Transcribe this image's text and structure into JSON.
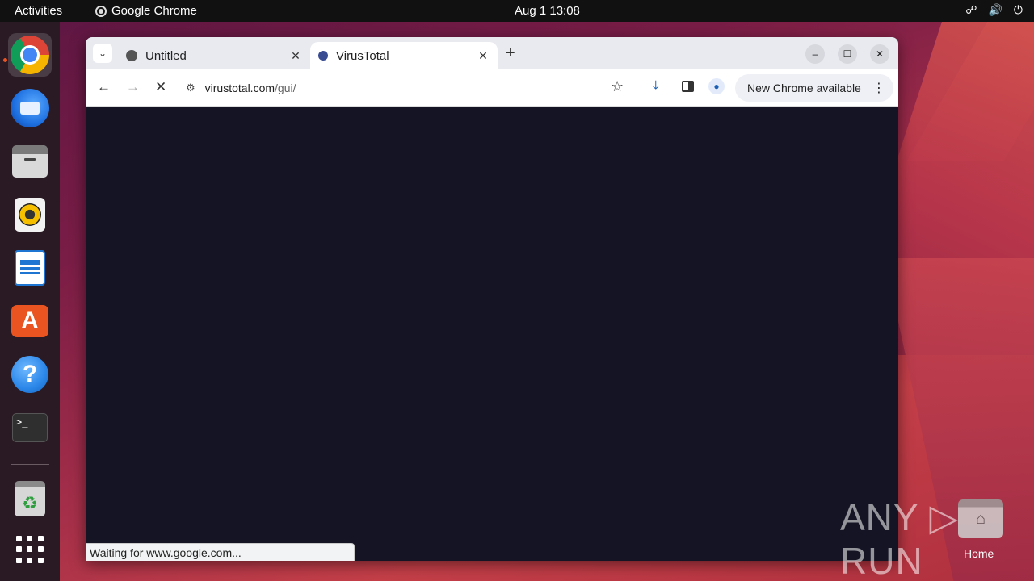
{
  "topbar": {
    "activities": "Activities",
    "app_name": "Google Chrome",
    "clock": "Aug 1  13:08",
    "tray": {
      "network": "☍",
      "volume": "🔊",
      "power": "⏻"
    }
  },
  "dock": {
    "items": [
      {
        "name": "google-chrome",
        "icon": "chrome-icon"
      },
      {
        "name": "thunderbird",
        "icon": "thunderbird-icon"
      },
      {
        "name": "files",
        "icon": "files-icon"
      },
      {
        "name": "rhythmbox",
        "icon": "rhythmbox-icon"
      },
      {
        "name": "libreoffice-writer",
        "icon": "writer-icon"
      },
      {
        "name": "app-center",
        "icon": "store-icon",
        "glyph": "A"
      },
      {
        "name": "help",
        "icon": "help-icon",
        "glyph": "?"
      },
      {
        "name": "terminal",
        "icon": "terminal-icon",
        "glyph": ">_"
      },
      {
        "name": "trash",
        "icon": "trash-icon",
        "glyph": "♻"
      },
      {
        "name": "show-apps",
        "icon": "apps-grid-icon"
      }
    ]
  },
  "browser": {
    "tabs": [
      {
        "title": "Untitled",
        "active": false
      },
      {
        "title": "VirusTotal",
        "active": true
      }
    ],
    "new_tab_glyph": "+",
    "window_controls": {
      "minimize": "–",
      "maximize": "☐",
      "close": "✕"
    },
    "toolbar": {
      "back": "←",
      "forward": "→",
      "stop": "✕",
      "url_host": "virustotal.com",
      "url_path": "/gui/",
      "bookmark_star": "☆",
      "download": "⤓",
      "profile": "●",
      "update_label": "New Chrome available",
      "menu": "⋮"
    },
    "status_text": "Waiting for www.google.com..."
  },
  "desktop": {
    "watermark": "ANY ▷ RUN",
    "home_label": "Home"
  },
  "colors": {
    "page_bg": "#141424",
    "accent": "#e95420",
    "tabstrip": "#e8eaf0"
  }
}
